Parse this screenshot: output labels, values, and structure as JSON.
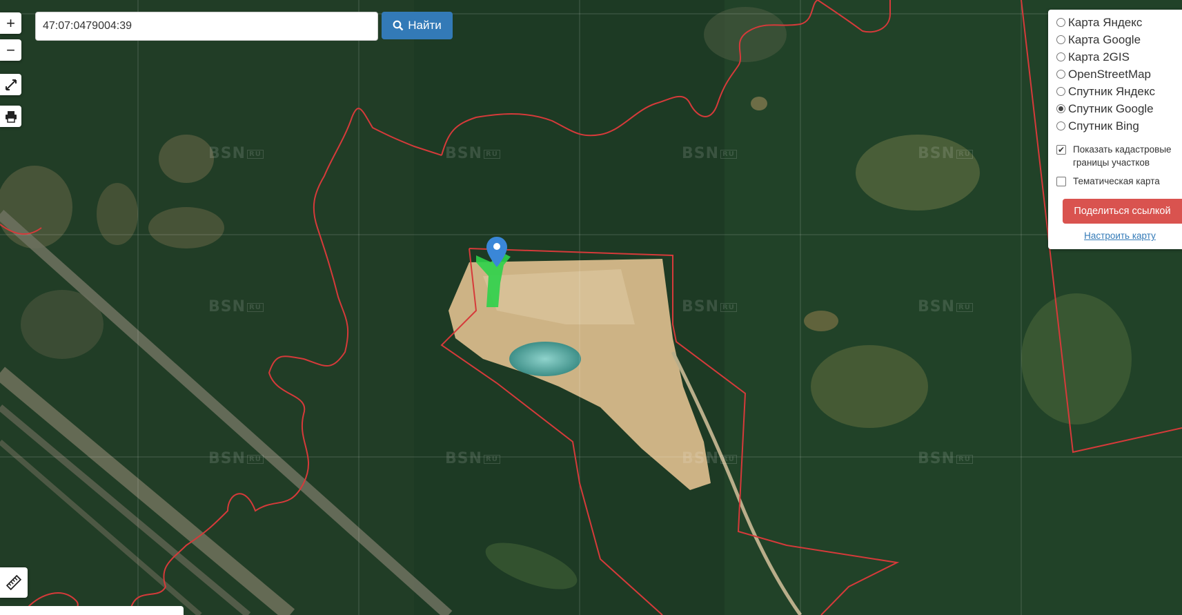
{
  "map": {
    "type": "satellite",
    "watermark": "BSN",
    "watermark_suffix": "RU",
    "marker_icon": "map-pin-icon"
  },
  "controls": {
    "zoom_in_label": "+",
    "zoom_out_label": "−",
    "fullscreen_icon": "expand-icon",
    "print_icon": "printer-icon",
    "ruler_icon": "ruler-icon"
  },
  "search": {
    "value": "47:07:0479004:39",
    "button_label": "Найти",
    "button_icon": "search-icon"
  },
  "layers": {
    "options": [
      {
        "label": "Карта Яндекс",
        "selected": false
      },
      {
        "label": "Карта Google",
        "selected": false
      },
      {
        "label": "Карта 2GIS",
        "selected": false
      },
      {
        "label": "OpenStreetMap",
        "selected": false
      },
      {
        "label": "Спутник Яндекс",
        "selected": false
      },
      {
        "label": "Спутник Google",
        "selected": true
      },
      {
        "label": "Спутник Bing",
        "selected": false
      }
    ],
    "cadastral_label": "Показать кадастровые границы участков",
    "cadastral_checked": true,
    "thematic_label": "Тематическая карта",
    "thematic_checked": false,
    "share_label": "Поделиться ссылкой",
    "setup_label": "Настроить карту"
  },
  "colors": {
    "boundary": "#d63a3a",
    "search_button": "#337ab7",
    "share_button": "#d9534f",
    "highlight_parcel": "#2ed14a"
  }
}
